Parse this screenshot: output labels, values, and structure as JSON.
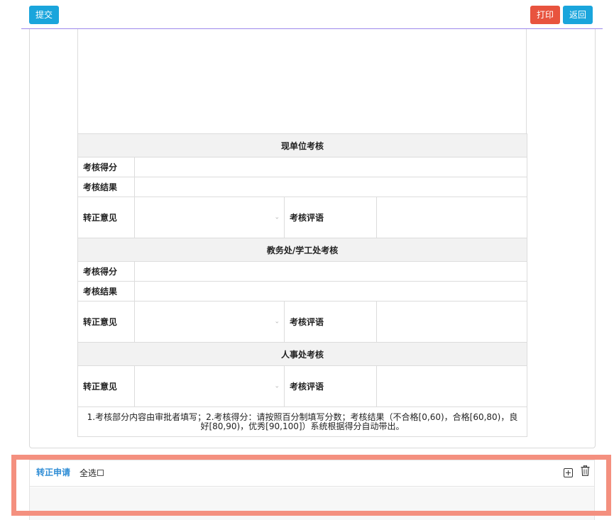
{
  "toolbar": {
    "submit_label": "提交",
    "print_label": "打印",
    "back_label": "返回"
  },
  "sections": {
    "current_unit": {
      "title": "现单位考核",
      "score_label": "考核得分",
      "result_label": "考核结果",
      "opinion_label": "转正意见",
      "comment_label": "考核评语"
    },
    "academic_affairs": {
      "title": "教务处/学工处考核",
      "score_label": "考核得分",
      "result_label": "考核结果",
      "opinion_label": "转正意见",
      "comment_label": "考核评语"
    },
    "hr": {
      "title": "人事处考核",
      "opinion_label": "转正意见",
      "comment_label": "考核评语"
    }
  },
  "note": "1.考核部分内容由审批者填写；2.考核得分：请按照百分制填写分数；考核结果（不合格[0,60)，合格[60,80)，良好[80,90)，优秀[90,100]）系统根据得分自动带出。",
  "list": {
    "title": "转正申请",
    "select_all_label": "全选"
  },
  "colors": {
    "primary": "#1aa5dc",
    "danger": "#e8533e",
    "note_text": "#e8271e",
    "highlight_border": "#f4907f",
    "list_title": "#2f8dd5"
  },
  "icons": {
    "select_caret": "chevron-down-icon",
    "add": "add-square-icon",
    "delete": "trash-icon"
  }
}
